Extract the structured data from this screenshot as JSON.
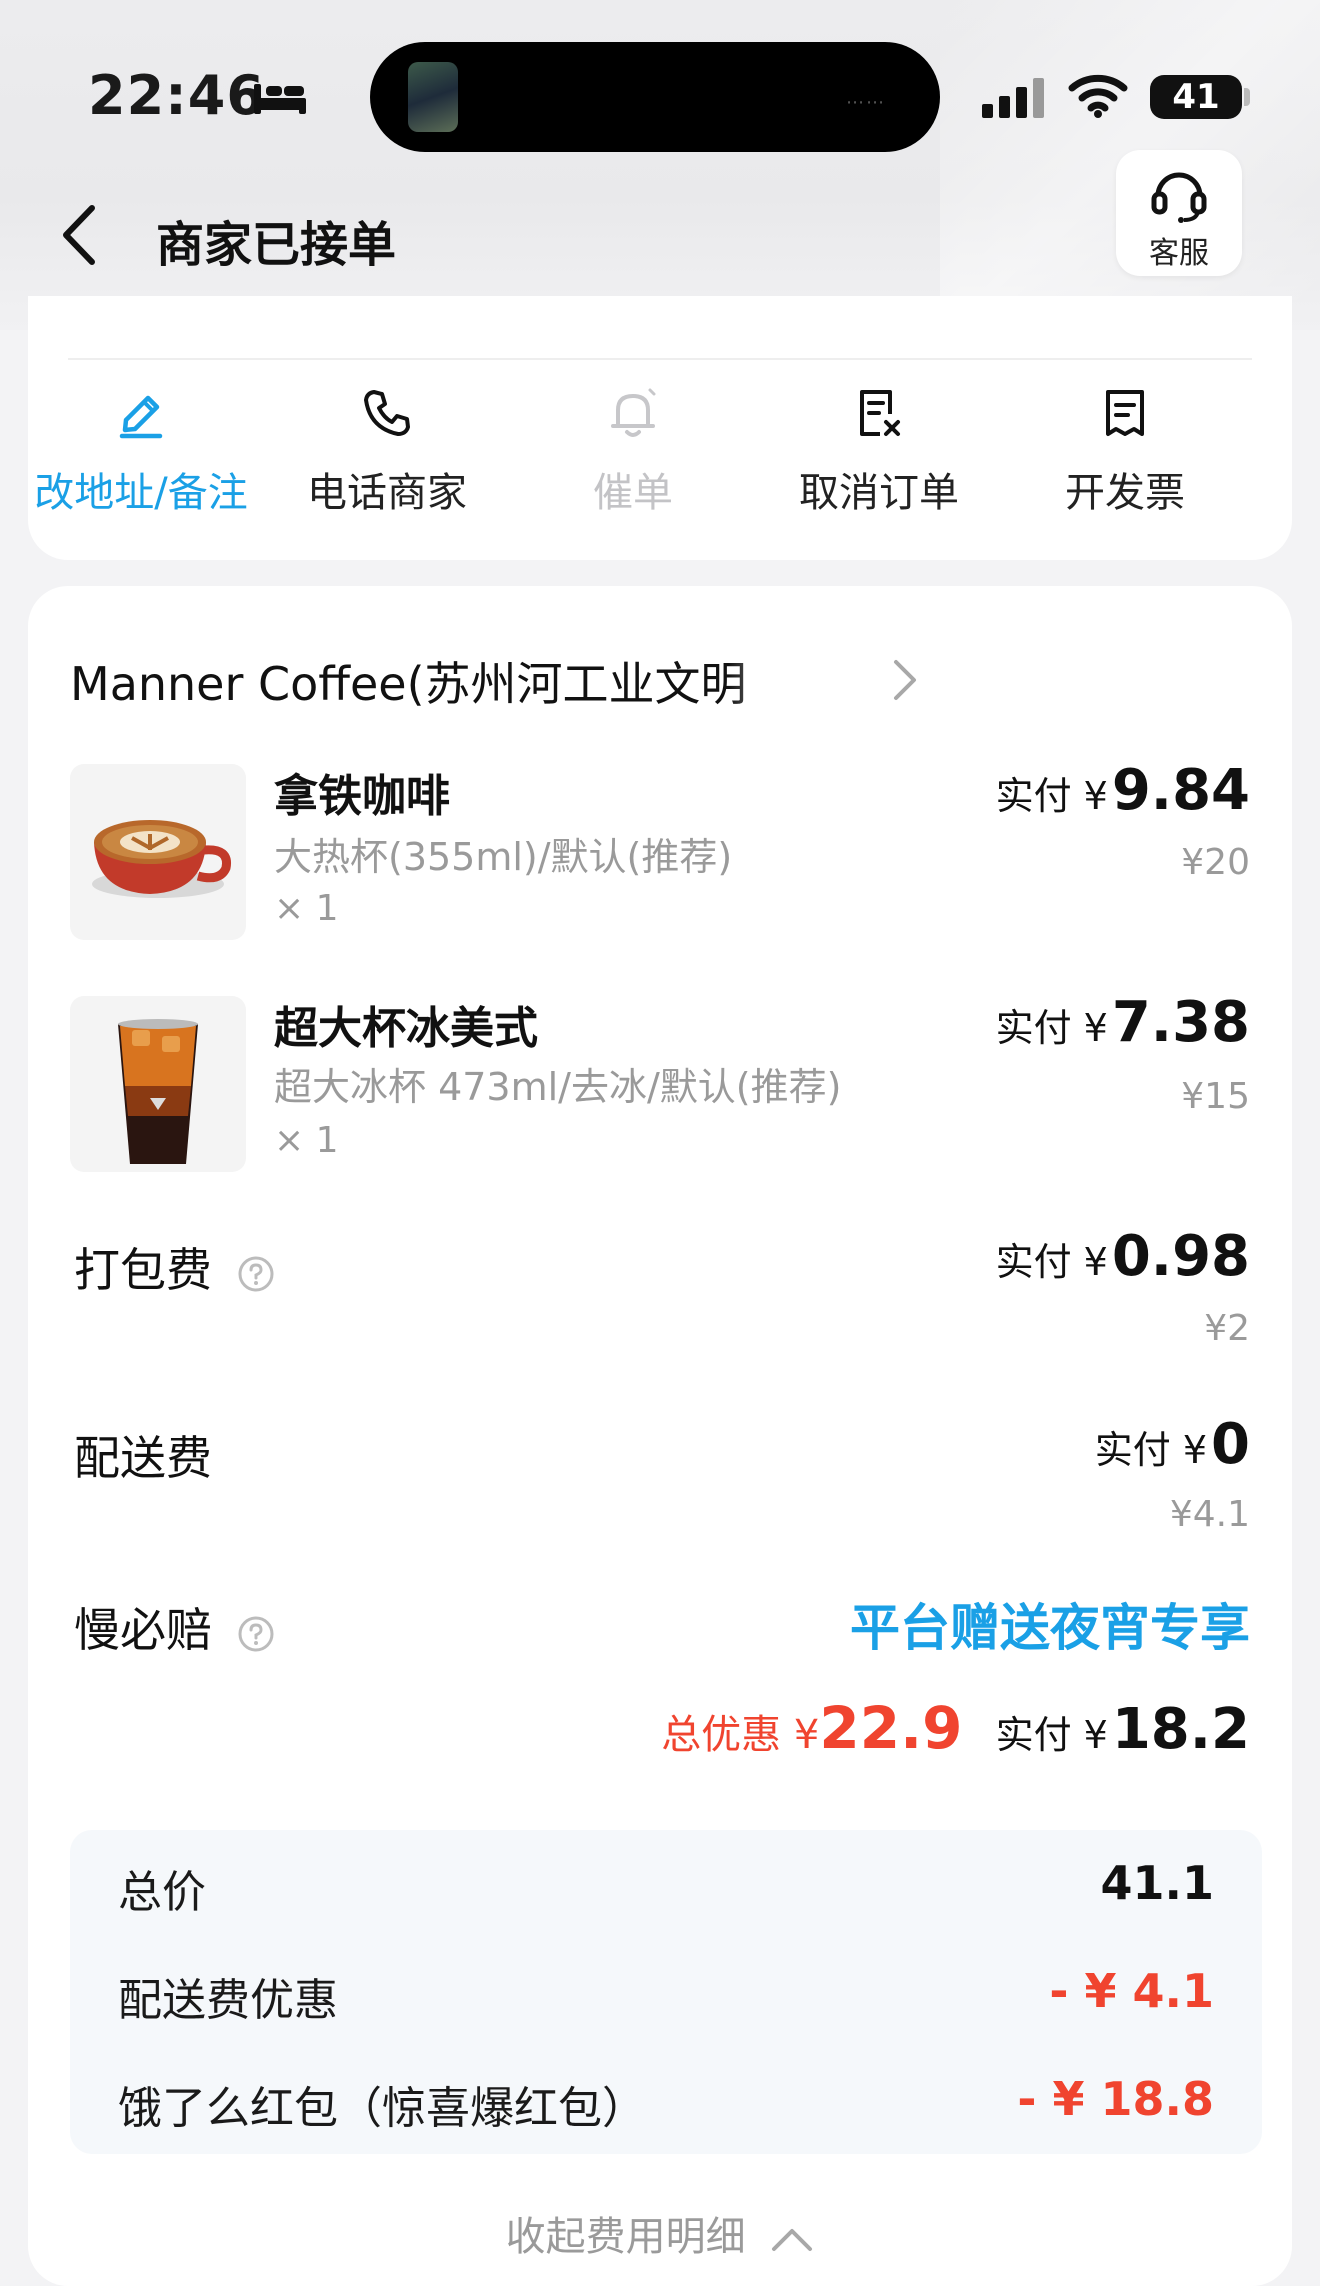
{
  "status_bar": {
    "time": "22:46",
    "battery": "41"
  },
  "header": {
    "title": "商家已接单",
    "service_label": "客服"
  },
  "actions": [
    {
      "label": "改地址/备注",
      "icon": "edit-address-icon",
      "state": "active"
    },
    {
      "label": "电话商家",
      "icon": "phone-icon",
      "state": "normal"
    },
    {
      "label": "催单",
      "icon": "bell-icon",
      "state": "disabled"
    },
    {
      "label": "取消订单",
      "icon": "cancel-order-icon",
      "state": "normal"
    },
    {
      "label": "开发票",
      "icon": "invoice-icon",
      "state": "normal"
    }
  ],
  "order": {
    "store_name": "Manner Coffee(苏州河工业文明",
    "items": [
      {
        "name": "拿铁咖啡",
        "spec": "大热杯(355ml)/默认(推荐)",
        "qty": "× 1",
        "paid_label": "实付 ¥",
        "paid_amount": "9.84",
        "original": "¥20"
      },
      {
        "name": "超大杯冰美式",
        "spec": "超大冰杯 473ml/去冰/默认(推荐)",
        "qty": "× 1",
        "paid_label": "实付 ¥",
        "paid_amount": "7.38",
        "original": "¥15"
      }
    ],
    "fees": {
      "packing": {
        "label": "打包费",
        "paid_label": "实付 ¥",
        "paid_amount": "0.98",
        "original": "¥2"
      },
      "delivery": {
        "label": "配送费",
        "paid_label": "实付 ¥",
        "paid_amount": "0",
        "original": "¥4.1"
      },
      "slow_compensation": {
        "label": "慢必赔",
        "promo": "平台赠送夜宵专享"
      }
    },
    "summary": {
      "discount_label": "总优惠 ¥",
      "discount_amount": "22.9",
      "paid_label": "实付 ¥",
      "paid_amount": "18.2"
    },
    "breakdown": [
      {
        "label": "总价",
        "value": "41.1"
      },
      {
        "label": "配送费优惠",
        "value": "- ¥ 4.1"
      },
      {
        "label": "饿了么红包（惊喜爆红包）",
        "value": "- ¥ 18.8"
      }
    ],
    "collapse_label": "收起费用明细"
  },
  "colors": {
    "accent": "#1aa0e6",
    "discount": "#f0442f",
    "muted": "#9a9a9a"
  }
}
